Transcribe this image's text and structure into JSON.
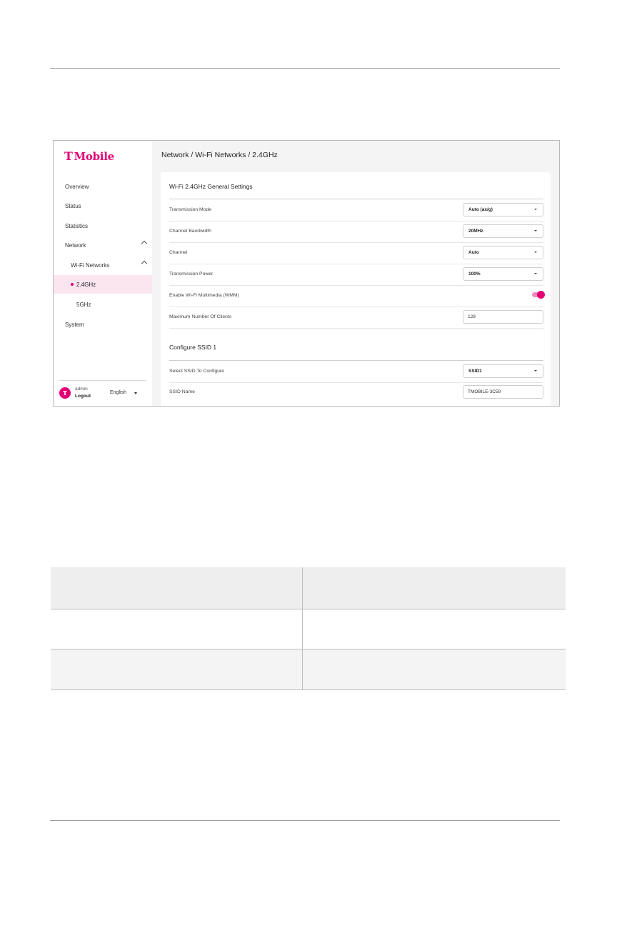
{
  "app": {
    "logo": "Mobile",
    "logo_mark": "T",
    "breadcrumb": "Network / Wi-Fi Networks / 2.4GHz"
  },
  "sidebar": {
    "items": [
      {
        "label": "Overview"
      },
      {
        "label": "Status"
      },
      {
        "label": "Statistics"
      },
      {
        "label": "Network"
      },
      {
        "label": "Wi-Fi Networks"
      },
      {
        "label": "2.4GHz"
      },
      {
        "label": "5GHz"
      },
      {
        "label": "System"
      }
    ],
    "user": "admin",
    "logout": "Logout",
    "avatar": "T",
    "language": "English"
  },
  "general": {
    "title": "Wi-Fi 2.4GHz General Settings",
    "rows": [
      {
        "label": "Transmission Mode",
        "value": "Auto (ax/g)"
      },
      {
        "label": "Channel Bandwidth",
        "value": "20MHz"
      },
      {
        "label": "Channel",
        "value": "Auto"
      },
      {
        "label": "Transmission Power",
        "value": "100%"
      },
      {
        "label": "Enable Wi-Fi Multimedia (WMM)",
        "toggle": true
      },
      {
        "label": "Maximum Number Of Clients",
        "value": "128"
      }
    ]
  },
  "ssid": {
    "title": "Configure SSID 1",
    "rows": [
      {
        "label": "Select SSID To Configure",
        "value": "SSID1"
      },
      {
        "label": "SSID Name",
        "value": "TMOBILE-3C59"
      }
    ]
  },
  "colors": {
    "brand": "#e20074",
    "active_bg": "#fbe6f0",
    "table_header_bg": "#eeeeee",
    "table_row_bg": "#f4f4f4"
  }
}
